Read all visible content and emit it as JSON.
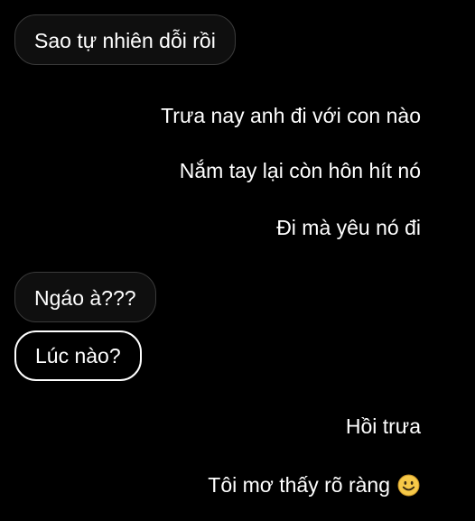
{
  "colors": {
    "background": "#000000",
    "text": "#ffffff",
    "incoming_bubble_fill": "#0f0f0f",
    "incoming_bubble_border": "#3a3a3a",
    "selected_bubble_border": "#ffffff",
    "emoji_face": "#f7c948"
  },
  "messages": [
    {
      "direction": "incoming",
      "text": "Sao tự nhiên dỗi rồi"
    },
    {
      "direction": "outgoing",
      "text": "Trưa nay anh đi với con nào"
    },
    {
      "direction": "outgoing",
      "text": "Nắm tay lại còn hôn hít nó"
    },
    {
      "direction": "outgoing",
      "text": "Đi mà yêu nó đi"
    },
    {
      "direction": "incoming",
      "text": "Ngáo à???"
    },
    {
      "direction": "incoming",
      "text": "Lúc nào?",
      "selected": true
    },
    {
      "direction": "outgoing",
      "text": "Hồi trưa"
    },
    {
      "direction": "outgoing",
      "text": "Tôi mơ thấy rõ ràng",
      "icon": "smiling-face-emoji"
    }
  ]
}
